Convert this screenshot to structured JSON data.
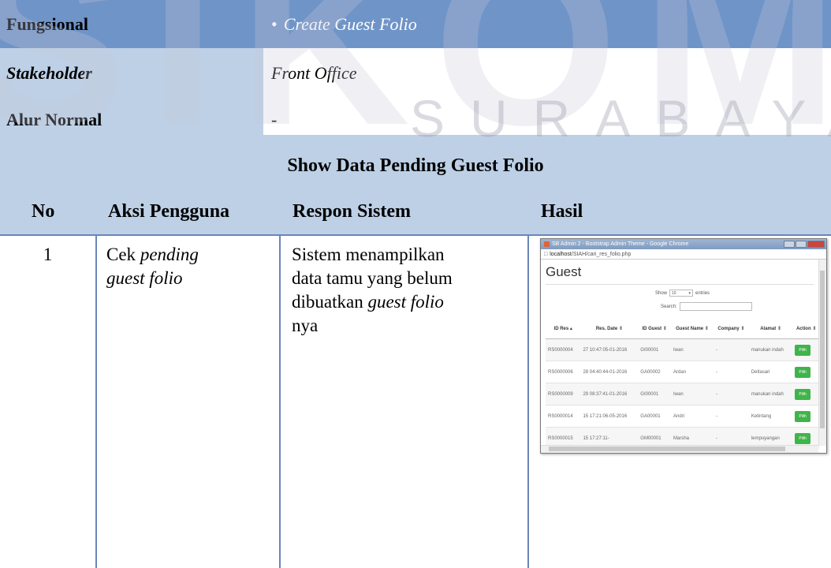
{
  "watermark": {
    "big": "SIKOM",
    "small": "SURABAYA"
  },
  "rows": {
    "fungsional": {
      "label": "Fungsional",
      "value_bullet": "•",
      "value": "Create Guest Folio"
    },
    "stakeholder": {
      "label": "Stakeholder",
      "value": "Front Office"
    },
    "alur_normal": {
      "label": "Alur Normal",
      "value": "-"
    }
  },
  "section_title": "Show Data Pending Guest Folio",
  "columns": {
    "no": "No",
    "aksi": "Aksi Pengguna",
    "respon": "Respon Sistem",
    "hasil": "Hasil"
  },
  "steps": [
    {
      "no": "1",
      "aksi_pre": "Cek ",
      "aksi_italic": "pending",
      "aksi_italic2": "guest folio",
      "respon_l1": "Sistem menampilkan",
      "respon_l2": "data tamu yang belum",
      "respon_l3_pre": "dibuatkan ",
      "respon_l3_italic": "guest folio",
      "respon_l4": "nya"
    }
  ],
  "screenshot": {
    "window_title": "SB Admin 2 - Bootstrap Admin Theme - Google Chrome",
    "url_host": "localhost",
    "url_path": "/SIAH/cari_res_folio.php",
    "heading": "Guest",
    "show_label": "Show",
    "show_value": "10",
    "entries_label": "entries",
    "search_label": "Search:",
    "headers": [
      "ID Res",
      "Res. Date",
      "ID Guest",
      "Guest Name",
      "Company",
      "Alamat",
      "Action"
    ],
    "rows": [
      {
        "id": "RS0000004",
        "date": "27 10:47:05-01-2016",
        "guest_id": "GI00001",
        "name": "Iwan",
        "company": "-",
        "alamat": "manukan indah",
        "action": "Pilih"
      },
      {
        "id": "RS0000006",
        "date": "28 04:40:44-01-2016",
        "guest_id": "GA00002",
        "name": "Ardan",
        "company": "-",
        "alamat": "Deltasari",
        "action": "Pilih"
      },
      {
        "id": "RS0000009",
        "date": "29 08:37:41-01-2016",
        "guest_id": "GI00001",
        "name": "Iwan",
        "company": "-",
        "alamat": "manukan indah",
        "action": "Pilih"
      },
      {
        "id": "RS0000014",
        "date": "15 17:21:06-05-2016",
        "guest_id": "GA00001",
        "name": "Andri",
        "company": "-",
        "alamat": "Ketintang",
        "action": "Pilih"
      },
      {
        "id": "RS0000015",
        "date": "15 17:27:11-",
        "guest_id": "GM00001",
        "name": "Marsha",
        "company": "-",
        "alamat": "lempuyangan",
        "action": "Pilih"
      }
    ]
  },
  "colors": {
    "band_dark": "#6f94c8",
    "band_light": "#bdd0e6",
    "border": "#6b86b8"
  }
}
